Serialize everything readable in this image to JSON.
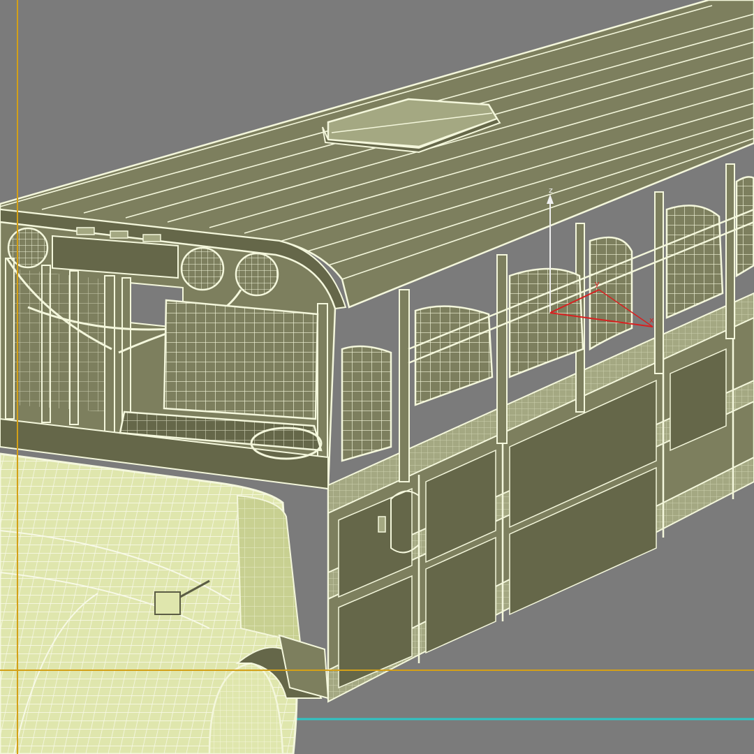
{
  "viewport": {
    "background_color": "#7b7b7b",
    "safe_frame_color": "#d4a017",
    "ground_line_color": "#2fc4c4"
  },
  "model": {
    "shaded_color": "#7d7f5e",
    "shaded_dark_color": "#656749",
    "wire_color": "#f4f7dc",
    "hood_color": "#dfe6ad"
  },
  "gizmo": {
    "x_label": "x",
    "y_label": "y",
    "z_label": "z",
    "x_color": "#d82020",
    "z_color": "#f0f0f0"
  }
}
